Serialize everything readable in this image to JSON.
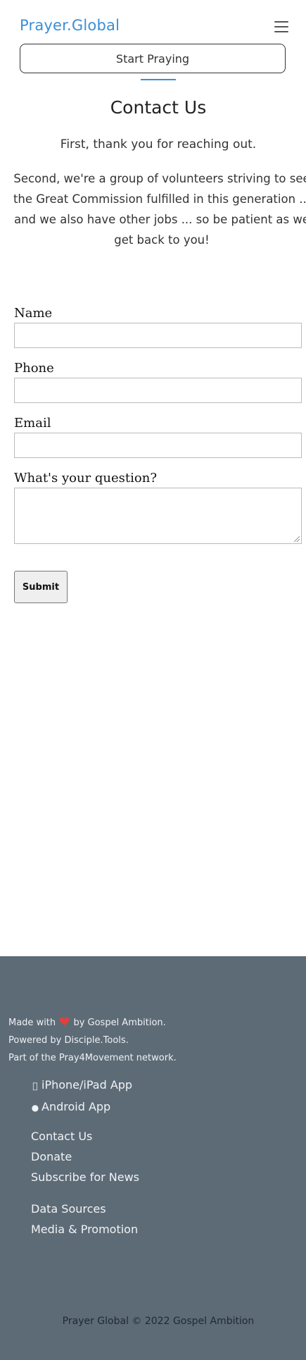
{
  "header": {
    "brand": "Prayer.Global",
    "menu_icon": "hamburger-menu-icon",
    "start_button": "Start Praying",
    "accent_color": "#3a8fd6"
  },
  "main": {
    "title": "Contact Us",
    "intro_line1": "First, thank you for reaching out.",
    "intro_line2": "Second, we're a group of volunteers striving to see the Great Commission fulfilled in this generation ... and we also have other jobs ... so be patient as we get back to you!"
  },
  "form": {
    "name_label": "Name",
    "name_value": "",
    "phone_label": "Phone",
    "phone_value": "",
    "email_label": "Email",
    "email_value": "",
    "question_label": "What's your question?",
    "question_value": "",
    "submit_label": "Submit"
  },
  "footer": {
    "background": "#5d6b77",
    "made_prefix": "Made with",
    "made_suffix": "by Gospel Ambition.",
    "heart_icon": "heart-icon",
    "powered": "Powered by Disciple.Tools.",
    "network": "Part of the Pray4Movement network.",
    "apps": [
      {
        "icon": "apple-icon",
        "label": "iPhone/iPad App"
      },
      {
        "icon": "android-icon",
        "label": "Android App"
      }
    ],
    "nav1": [
      "Contact Us",
      "Donate",
      "Subscribe for News"
    ],
    "nav2": [
      "Data Sources",
      "Media & Promotion"
    ],
    "copyright": "Prayer Global © 2022 Gospel Ambition"
  }
}
